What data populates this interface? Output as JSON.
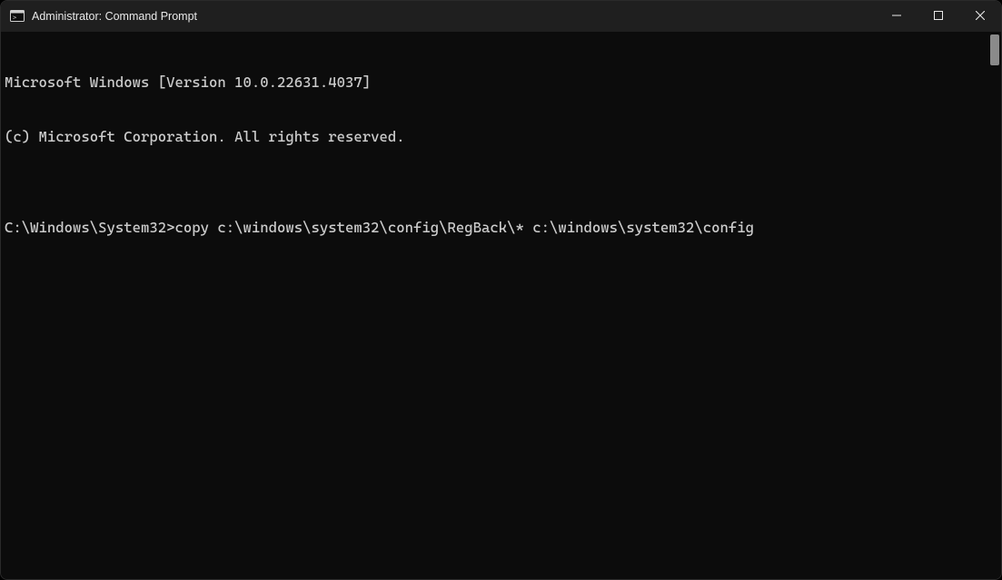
{
  "window": {
    "title": "Administrator: Command Prompt",
    "icons": {
      "app": "cmd-icon",
      "minimize": "minimize-icon",
      "maximize": "maximize-icon",
      "close": "close-icon"
    }
  },
  "terminal": {
    "lines": [
      "Microsoft Windows [Version 10.0.22631.4037]",
      "(c) Microsoft Corporation. All rights reserved.",
      ""
    ],
    "prompt": "C:\\Windows\\System32>",
    "command": "copy c:\\windows\\system32\\config\\RegBack\\* c:\\windows\\system32\\config"
  }
}
